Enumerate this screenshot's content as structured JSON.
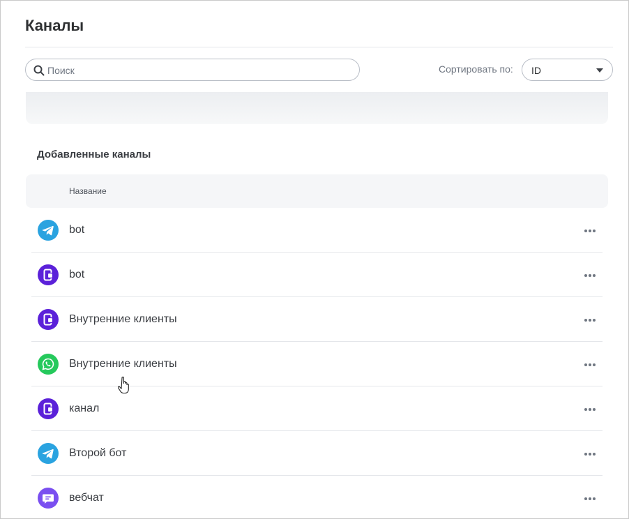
{
  "page": {
    "title": "Каналы"
  },
  "search": {
    "placeholder": "Поиск",
    "value": ""
  },
  "sort": {
    "label": "Сортировать по:",
    "selected": "ID"
  },
  "section": {
    "title": "Добавленные каналы"
  },
  "table": {
    "header_name": "Название"
  },
  "channels": [
    {
      "name": "bot",
      "type": "telegram",
      "icon": "telegram-icon",
      "color": "#2aa3e0"
    },
    {
      "name": "bot",
      "type": "mobile",
      "icon": "mobile-app-icon",
      "color": "#5b21d9"
    },
    {
      "name": "Внутренние клиенты",
      "type": "mobile",
      "icon": "mobile-app-icon",
      "color": "#5b21d9"
    },
    {
      "name": "Внутренние клиенты",
      "type": "whatsapp",
      "icon": "whatsapp-icon",
      "color": "#25c95c"
    },
    {
      "name": "канал",
      "type": "mobile",
      "icon": "mobile-app-icon",
      "color": "#5b21d9"
    },
    {
      "name": "Второй бот",
      "type": "telegram",
      "icon": "telegram-icon",
      "color": "#2aa3e0"
    },
    {
      "name": "вебчат",
      "type": "webchat",
      "icon": "webchat-icon",
      "color": "#7a4ff0"
    }
  ]
}
